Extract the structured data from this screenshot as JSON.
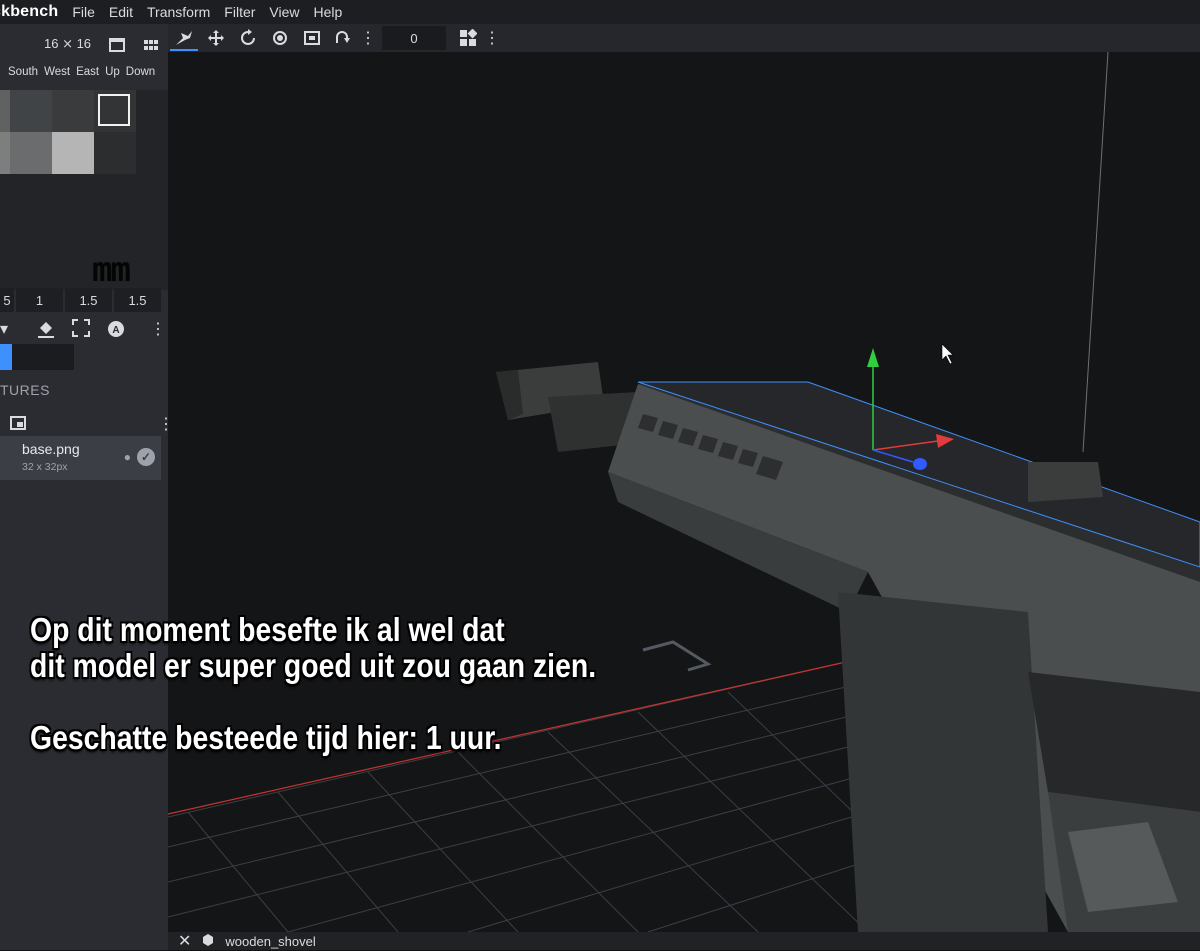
{
  "app": {
    "title": "ckbench"
  },
  "menu": [
    "File",
    "Edit",
    "Transform",
    "Filter",
    "View",
    "Help"
  ],
  "toolbar": {
    "tools": [
      "move-tool-icon",
      "translate-icon",
      "rotate-icon",
      "pivot-icon",
      "resize-icon",
      "mirror-icon"
    ],
    "frame_value": "0"
  },
  "uv_editor": {
    "size_label": "16 ⨯ 16",
    "faces": [
      "South",
      "West",
      "East",
      "Up",
      "Down"
    ],
    "active_face": "Up",
    "values": [
      "5",
      "1",
      "1.5",
      "1.5"
    ]
  },
  "textures": {
    "section_title": "TURES",
    "items": [
      {
        "name": "base.png",
        "size": "32 x 32px"
      }
    ]
  },
  "status": {
    "model_name": "wooden_shovel"
  },
  "caption": {
    "line1": "Op dit moment besefte ik al wel dat",
    "line2": "dit model er super goed uit zou gaan zien.",
    "line3": "Geschatte besteede tijd hier: 1 uur."
  },
  "colors": {
    "accent": "#3e90ff",
    "axis_x": "#e23b3b",
    "axis_y": "#2fcf3f",
    "axis_z": "#2f5bff"
  }
}
